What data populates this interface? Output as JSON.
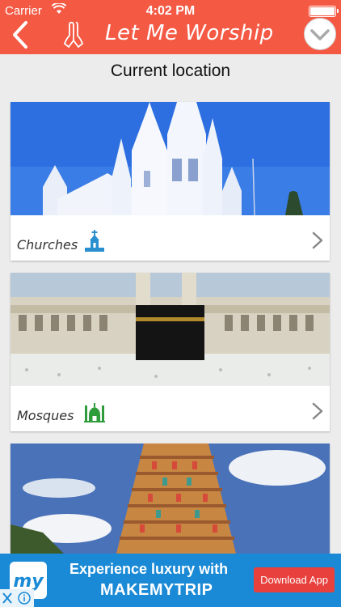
{
  "status_bar": {
    "carrier": "Carrier",
    "time": "4:02 PM"
  },
  "nav": {
    "title": "Let Me Worship"
  },
  "location": {
    "label": "Current location"
  },
  "cards": [
    {
      "label": "Churches"
    },
    {
      "label": "Mosques"
    },
    {
      "label": ""
    }
  ],
  "ad": {
    "line1": "Experience luxury with",
    "line2": "MAKEMYTRIP",
    "button": "Download App",
    "logo_text": "my"
  },
  "colors": {
    "accent": "#f45944",
    "card_bg": "#ffffff",
    "page_bg": "#ececec",
    "ad_bg": "#1a8ad6",
    "ad_button": "#e8403c",
    "church_icon": "#2a8fd0",
    "mosque_icon": "#2e9c3a"
  },
  "icons": [
    "wifi-icon",
    "battery-icon",
    "back-chevron-icon",
    "praying-hands-icon",
    "chevron-down-icon",
    "church-icon",
    "mosque-icon",
    "chevron-right-icon",
    "close-icon",
    "info-icon"
  ]
}
